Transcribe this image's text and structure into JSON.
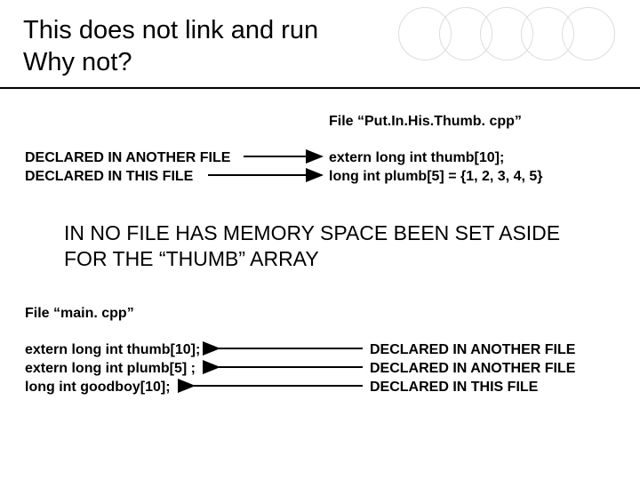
{
  "title": "This does not link and run\nWhy not?",
  "file1_label": "File “Put.In.His.Thumb. cpp”",
  "block1": {
    "left": {
      "line1": "DECLARED IN ANOTHER FILE",
      "line2": "DECLARED IN THIS FILE"
    },
    "right": {
      "line1": "extern long int thumb[10];",
      "line2": "long int plumb[5] = {1, 2, 3, 4, 5}"
    }
  },
  "mid_text": "IN NO FILE HAS MEMORY SPACE BEEN SET ASIDE FOR THE “THUMB” ARRAY",
  "file2_label": "File “main. cpp”",
  "block2": {
    "left": {
      "line1": "extern long int thumb[10];",
      "line2": "extern long int plumb[5] ;",
      "line3": "long int goodboy[10];"
    },
    "right": {
      "line1": "DECLARED IN ANOTHER FILE",
      "line2": "DECLARED IN ANOTHER FILE",
      "line3": "DECLARED IN THIS FILE"
    }
  }
}
